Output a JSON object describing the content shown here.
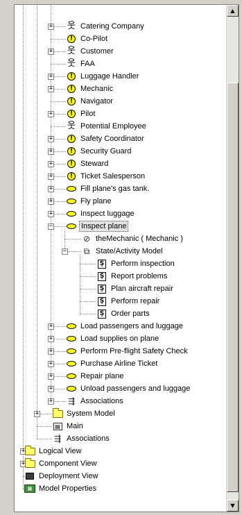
{
  "tree": {
    "items": [
      {
        "label": "Catering Company",
        "icon": "actor-icon",
        "expander": "+"
      },
      {
        "label": "Co-Pilot",
        "icon": "boundary-icon",
        "expander": ""
      },
      {
        "label": "Customer",
        "icon": "actor-icon",
        "expander": "+"
      },
      {
        "label": "FAA",
        "icon": "actor-icon",
        "expander": ""
      },
      {
        "label": "Luggage Handler",
        "icon": "boundary-icon",
        "expander": "+"
      },
      {
        "label": "Mechanic",
        "icon": "boundary-icon",
        "expander": "+"
      },
      {
        "label": "Navigator",
        "icon": "boundary-icon",
        "expander": ""
      },
      {
        "label": "Pilot",
        "icon": "boundary-icon",
        "expander": "+"
      },
      {
        "label": "Potential Employee",
        "icon": "actor-icon",
        "expander": ""
      },
      {
        "label": "Safety Coordinator",
        "icon": "boundary-icon",
        "expander": "+"
      },
      {
        "label": "Security Guard",
        "icon": "boundary-icon",
        "expander": "+"
      },
      {
        "label": "Steward",
        "icon": "boundary-icon",
        "expander": "+"
      },
      {
        "label": "Ticket Salesperson",
        "icon": "boundary-icon",
        "expander": "+"
      },
      {
        "label": "Fill plane's gas tank.",
        "icon": "use-case-icon",
        "expander": "+"
      },
      {
        "label": "Fly plane",
        "icon": "use-case-icon",
        "expander": "+"
      },
      {
        "label": "Inspect luggage",
        "icon": "use-case-icon",
        "expander": "+"
      },
      {
        "label": "Inspect plane",
        "icon": "use-case-icon",
        "expander": "-"
      },
      {
        "label": "theMechanic ( Mechanic )",
        "icon": "instance-icon",
        "expander": ""
      },
      {
        "label": "State/Activity Model",
        "icon": "state-model-icon",
        "expander": "-"
      },
      {
        "label": "Perform inspection",
        "icon": "activity-icon",
        "expander": ""
      },
      {
        "label": "Report problems",
        "icon": "activity-icon",
        "expander": ""
      },
      {
        "label": "Plan aircraft repair",
        "icon": "activity-icon",
        "expander": ""
      },
      {
        "label": "Perform repair",
        "icon": "activity-icon",
        "expander": ""
      },
      {
        "label": "Order parts",
        "icon": "activity-icon",
        "expander": ""
      },
      {
        "label": "Load passengers and luggage",
        "icon": "use-case-icon",
        "expander": "+"
      },
      {
        "label": "Load supplies on plane",
        "icon": "use-case-icon",
        "expander": "+"
      },
      {
        "label": "Perform Pre-flight Safety Check",
        "icon": "use-case-icon",
        "expander": "+"
      },
      {
        "label": "Purchase Airline Ticket",
        "icon": "use-case-icon",
        "expander": "+"
      },
      {
        "label": "Repair plane",
        "icon": "use-case-icon",
        "expander": "+"
      },
      {
        "label": "Unload passengers and luggage",
        "icon": "use-case-icon",
        "expander": "+"
      },
      {
        "label": "Associations",
        "icon": "associations-icon",
        "expander": "+"
      },
      {
        "label": "System Model",
        "icon": "folder-icon",
        "expander": "+"
      },
      {
        "label": "Main",
        "icon": "diagram-icon",
        "expander": ""
      },
      {
        "label": "Associations",
        "icon": "associations-icon",
        "expander": ""
      },
      {
        "label": "Logical View",
        "icon": "folder-icon",
        "expander": "+"
      },
      {
        "label": "Component View",
        "icon": "folder-icon",
        "expander": "+"
      },
      {
        "label": "Deployment View",
        "icon": "deployment-icon",
        "expander": ""
      },
      {
        "label": "Model Properties",
        "icon": "model-properties-icon",
        "expander": ""
      }
    ],
    "selected_label": "Inspect plane"
  },
  "scrollbar": {
    "up_arrow": "▲",
    "down_arrow": "▼",
    "up_icon": "scroll-up-icon",
    "down_icon": "scroll-down-icon"
  },
  "colors": {
    "use_case_fill": "#ffff00",
    "folder_fill": "#ffff66",
    "selection_bg": "#e4e4e4"
  }
}
